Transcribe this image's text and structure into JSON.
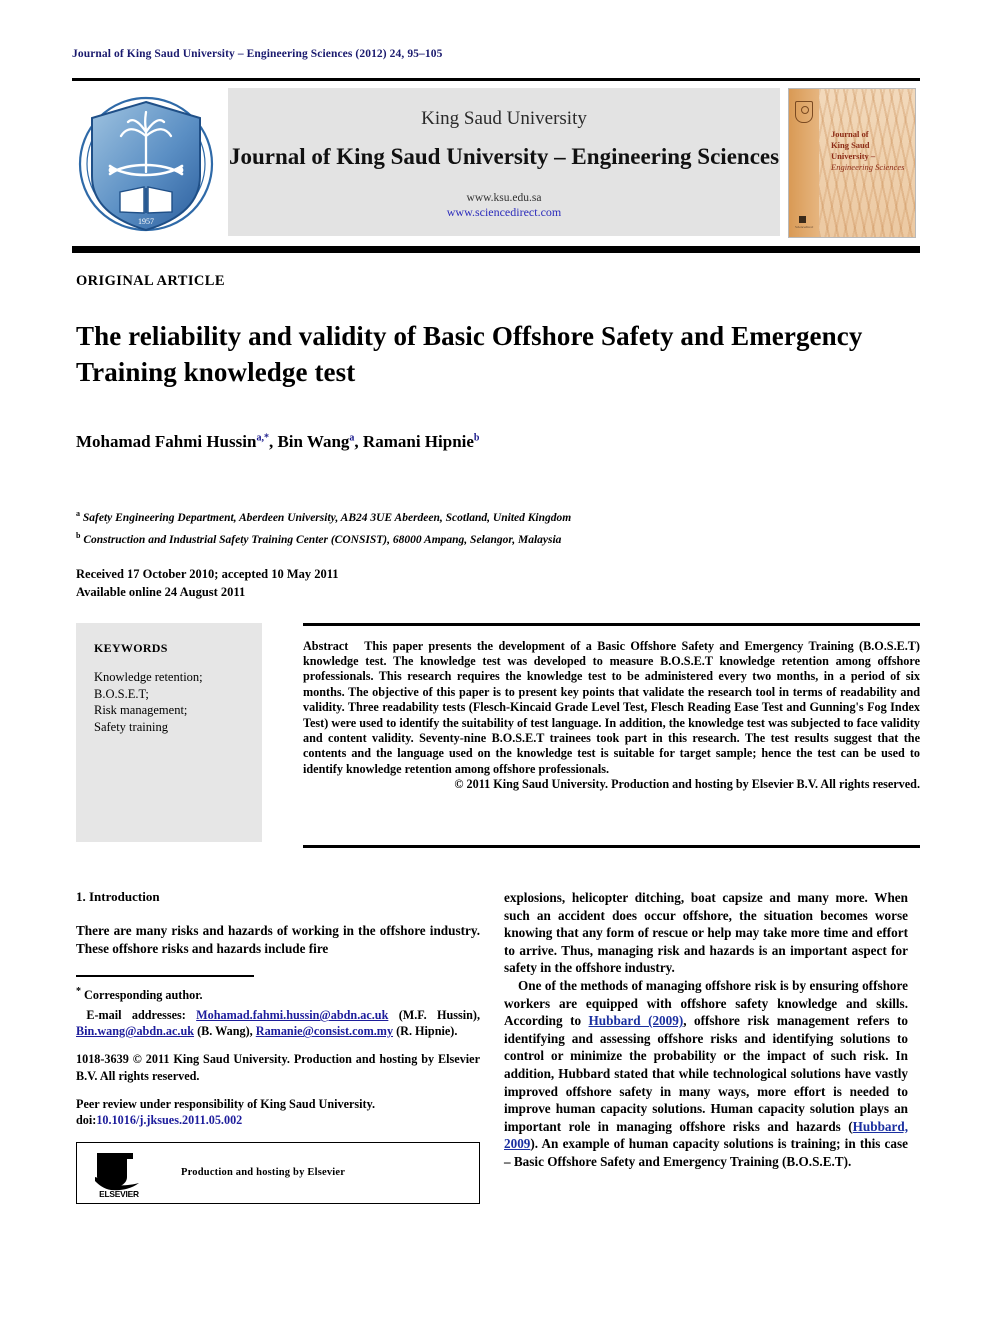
{
  "running_head": "Journal of King Saud University – Engineering Sciences (2012) 24, 95–105",
  "masthead": {
    "university": "King Saud University",
    "journal_title": "Journal of King Saud University – Engineering Sciences",
    "url_primary": "www.ksu.edu.sa",
    "url_secondary": "www.sciencedirect.com",
    "logo_alt": "King Saud University shield logo",
    "cover": {
      "line1": "Journal of",
      "line2": "King Saud University –",
      "line3": "Engineering Sciences",
      "publisher_mark": "Sciencedirect"
    }
  },
  "article": {
    "type_label": "ORIGINAL ARTICLE",
    "title": "The reliability and validity of Basic Offshore Safety and Emergency Training knowledge test",
    "authors": [
      {
        "name": "Mohamad Fahmi Hussin",
        "marks": "a,*"
      },
      {
        "name": "Bin Wang",
        "marks": "a"
      },
      {
        "name": "Ramani Hipnie",
        "marks": "b"
      }
    ],
    "affiliations": [
      {
        "mark": "a",
        "text": "Safety Engineering Department, Aberdeen University, AB24 3UE Aberdeen, Scotland, United Kingdom"
      },
      {
        "mark": "b",
        "text": "Construction and Industrial Safety Training Center (CONSIST), 68000 Ampang, Selangor, Malaysia"
      }
    ],
    "received_line": "Received 17 October 2010; accepted 10 May 2011",
    "available_line": "Available online 24 August 2011"
  },
  "keywords": {
    "heading": "KEYWORDS",
    "items": [
      "Knowledge retention;",
      "B.O.S.E.T;",
      "Risk management;",
      "Safety training"
    ]
  },
  "abstract": {
    "label": "Abstract",
    "text": "This paper presents the development of a Basic Offshore Safety and Emergency Training (B.O.S.E.T) knowledge test. The knowledge test was developed to measure B.O.S.E.T knowledge retention among offshore professionals. This research requires the knowledge test to be administered every two months, in a period of six months. The objective of this paper is to present key points that validate the research tool in terms of readability and validity. Three readability tests (Flesch-Kincaid Grade Level Test, Flesch Reading Ease Test and Gunning's Fog Index Test) were used to identify the suitability of test language. In addition, the knowledge test was subjected to face validity and content validity. Seventy-nine B.O.S.E.T trainees took part in this research. The test results suggest that the contents and the language used on the knowledge test is suitable for target sample; hence the test can be used to identify knowledge retention among offshore professionals.",
    "copyright": "© 2011 King Saud University. Production and hosting by Elsevier B.V. All rights reserved."
  },
  "body": {
    "section_heading": "1. Introduction",
    "left_paragraph": "There are many risks and hazards of working in the offshore industry. These offshore risks and hazards include fire",
    "right_paragraph_1": "explosions, helicopter ditching, boat capsize and many more. When such an accident does occur offshore, the situation becomes worse knowing that any form of rescue or help may take more time and effort to arrive. Thus, managing risk and hazards is an important aspect for safety in the offshore industry.",
    "right_paragraph_2_part1": "One of the methods of managing offshore risk is by ensuring offshore workers are equipped with offshore safety knowledge and skills. According to ",
    "right_paragraph_2_cite1": "Hubbard (2009)",
    "right_paragraph_2_part2": ", offshore risk management refers to identifying and assessing offshore risks and identifying solutions to control or minimize the probability or the impact of such risk. In addition, Hubbard stated that while technological solutions have vastly improved offshore safety in many ways, more effort is needed to improve human capacity solutions. Human capacity solution plays an important role in managing offshore risks and hazards (",
    "right_paragraph_2_cite2": "Hubbard, 2009",
    "right_paragraph_2_part3": "). An example of human capacity solutions is training; in this case – Basic Offshore Safety and Emergency Training (B.O.S.E.T)."
  },
  "footnotes": {
    "corresponding_mark": "*",
    "corresponding_text": "Corresponding author.",
    "email_label": "E-mail addresses:",
    "emails": [
      {
        "address": "Mohamad.fahmi.hussin@abdn.ac.uk",
        "owner": "(M.F. Hussin),"
      },
      {
        "address": "Bin.wang@abdn.ac.uk",
        "owner": "(B. Wang),"
      },
      {
        "address": "Ramanie@consist.com.my",
        "owner": "(R. Hipnie)."
      }
    ],
    "issn_line": "1018-3639 © 2011 King Saud University. Production and hosting by Elsevier B.V. All rights reserved.",
    "peer_review": "Peer review under responsibility of King Saud University.",
    "doi_label": "doi:",
    "doi_value": "10.1016/j.jksues.2011.05.002",
    "elsevier_caption": "Production and hosting by Elsevier",
    "elsevier_wordmark": "ELSEVIER"
  },
  "colors": {
    "running_head": "#1a1a6e",
    "link": "#1d1d9c",
    "citation": "#1a2fa0",
    "masthead_bg": "#e3e3e3",
    "keywords_bg": "#e6e6e6",
    "cover_accent": "#8c2b16"
  }
}
